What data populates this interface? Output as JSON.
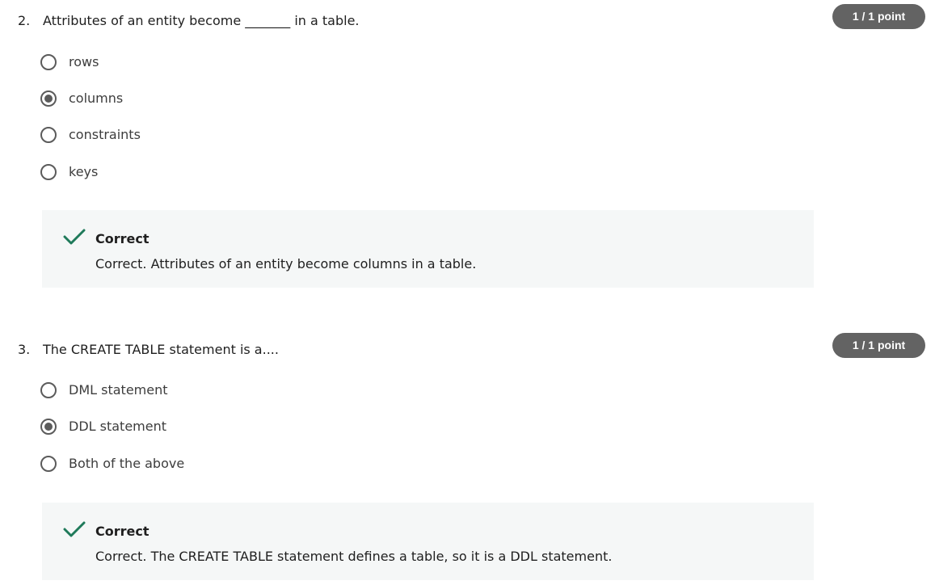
{
  "questions": [
    {
      "number": "2.",
      "prompt": "Attributes of an entity become _______ in a table.",
      "points": "1 / 1 point",
      "options": [
        {
          "label": "rows",
          "selected": false
        },
        {
          "label": "columns",
          "selected": true
        },
        {
          "label": "constraints",
          "selected": false
        },
        {
          "label": "keys",
          "selected": false
        }
      ],
      "feedback": {
        "title": "Correct",
        "text": "Correct. Attributes of an entity become columns in a table.",
        "icon": "checkmark-icon",
        "color": "#1f7a5a"
      }
    },
    {
      "number": "3.",
      "prompt": "The CREATE TABLE statement is a....",
      "points": "1 / 1 point",
      "options": [
        {
          "label": "DML statement",
          "selected": false
        },
        {
          "label": "DDL statement",
          "selected": true
        },
        {
          "label": "Both of the above",
          "selected": false
        }
      ],
      "feedback": {
        "title": "Correct",
        "text": "Correct. The CREATE TABLE statement defines a table, so it is a DDL statement.",
        "icon": "checkmark-icon",
        "color": "#1f7a5a"
      }
    }
  ]
}
